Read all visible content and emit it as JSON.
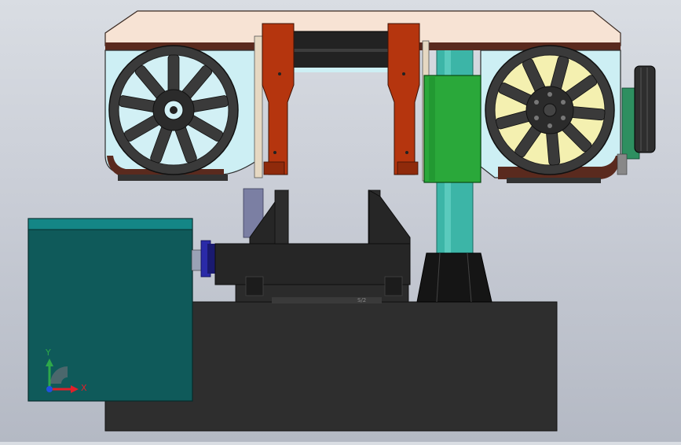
{
  "viewport": {
    "background_top": "#d9dde3",
    "background_bottom": "#b4b9c4"
  },
  "colors": {
    "cover_beige": "#f7e3d4",
    "housing_blue": "#cdeff4",
    "housing_brown": "#5a2a1e",
    "arm_red": "#b5350e",
    "column_teal": "#3cb5a7",
    "guide_green": "#2aa83a",
    "motor_teal": "#0f5a5a",
    "base_dark": "#333333",
    "wheel_dark": "#3a3a3a",
    "wheel_spoke_gap_left": "#d2f0f5",
    "wheel_spoke_gap_right": "#f4f0b0",
    "vise_blue_grey": "#7b7fa3",
    "coupling_blue": "#2a2aa8"
  },
  "triad": {
    "x_label": "X",
    "y_label": "Y",
    "x_color": "#e0202a",
    "y_color": "#2ea84a",
    "z_color": "#2050e0"
  }
}
